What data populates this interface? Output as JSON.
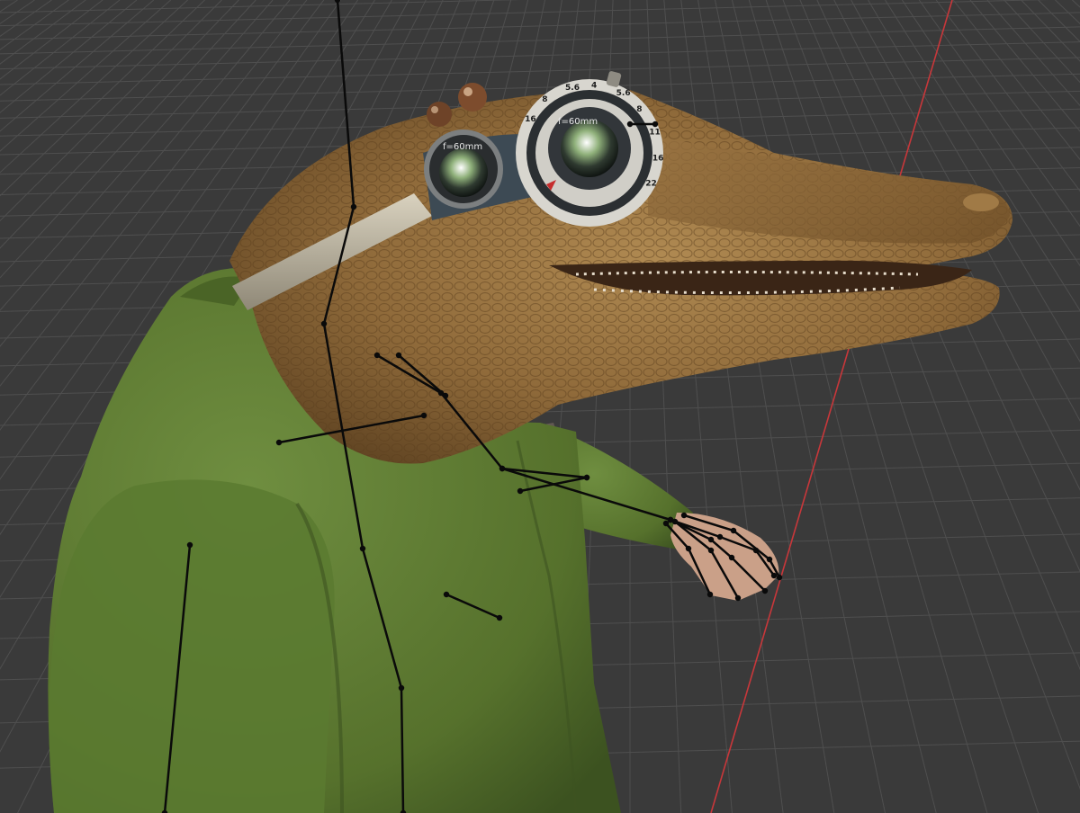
{
  "viewport": {
    "colors": {
      "background": "#3a3a3a",
      "grid_line": "#4f4f4f",
      "x_axis": "#c8373a",
      "armature_bone": "#0a0a0a",
      "jacket_green": "#5c7a33",
      "skin_brown": "#8f6a3a"
    }
  },
  "character": {
    "goggles": {
      "left_lens_label": "f=60mm",
      "right_lens_label": "f=60mm",
      "ring_numbers": [
        "16",
        "8",
        "5.6",
        "4",
        "5.6",
        "8",
        "11",
        "16",
        "22"
      ]
    }
  }
}
